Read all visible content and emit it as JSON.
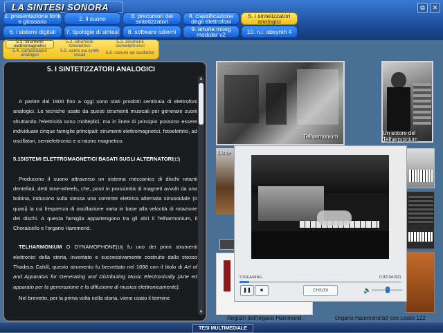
{
  "app": {
    "title": "LA SINTESI SONORA",
    "window_buttons": [
      "restore",
      "close"
    ]
  },
  "nav": {
    "row1": [
      "1. presentazione fonti e glossario",
      "2. il suono",
      "3. precursori dei sintetizzatori",
      "4. classificazione degli elettrofoni",
      "5. i sintetizzatori analogici"
    ],
    "row2": [
      "6. i sistemi digitali",
      "7. tipologie di sintesi",
      "8. software odierni",
      "9. arturia moog modular v2",
      "10. n.i. absynth 4"
    ]
  },
  "submenu": [
    "5.1. strumenti elettromagnetici",
    "5.2. strumenti fotoelettrici",
    "5.3. strumenti semielettronici",
    "5.4. campionatori analogici",
    "5.5. cenni sui synth vocali",
    "5.6. sistemi ad oscillatori"
  ],
  "content": {
    "title": "5. I SINTETIZZATORI ANALOGICI",
    "p1": "A partire dal 1900 fino a oggi sono stati prodotti centinaia di elettrofoni analogici. Le tecniche usate da questi strumenti musicali per generare suoni sfruttando l'elettricità sono molteplici, ma in linea di principio possono essere individuate cinque famiglie principali: strumenti elettromagnetici, fotoelettrici, ad oscillatori, semielettronici e a nastro magnetico.",
    "section": "5.1SISTEMI ELETTROMAGNETICI BASATI SUGLI ALTERNATORI",
    "section_ref": "[15]",
    "p2": "Producono il suono attraverso un sistema meccanico di dischi rotanti dentellati, detti tone-wheels, che, posti in prossimità di magneti avvolti da una bobina, inducono sulla stessa una corrente elettrica alternata sinusoidale (o quasi) la cui frequenza di oscillazione varia in base alla velocità di rotazione dei dischi. A questa famiglia appartengono tra gli altri il Telharmonium, il Choralcello e l'organo Hammond.",
    "p3_bold": "TELHARMONIUM",
    "p3_a": " O DYNAMOPHONE",
    "p3_ref": "[16]",
    "p3_b": " fu uno dei primi strumenti elettronici della storia, inventato e successivamente costruito dallo stesso Thadeus Cahill, questo strumento fu brevettato nel 1898 con il titolo di ",
    "p3_it": "Art of and Apparatus for Generating and Distributing Music Electronically (Arte ed apparato per la generazione e la diffusione di musica elettronicamente).",
    "p4": "Nel brevetto, per la prima volta nella storia, viene usato il termine"
  },
  "captions": {
    "telharmonium": "Telharmonium",
    "inventor": "Un sotore del Telharmonium",
    "interior": "L'inte",
    "registri": "Registri dell'organo Hammond",
    "organo": "Organo Hammond b3 con Leslie 122"
  },
  "player": {
    "status": "STREAMING",
    "time": "0:00:34.821",
    "progress": 0.06,
    "close_label": "CHIUDI"
  },
  "footer": {
    "label": "TESI MULTIMEDIALE"
  },
  "colors": {
    "nav_blue": "#2f80f0",
    "nav_active": "#f5cc2a",
    "panel_bg": "#1b1c1f"
  }
}
